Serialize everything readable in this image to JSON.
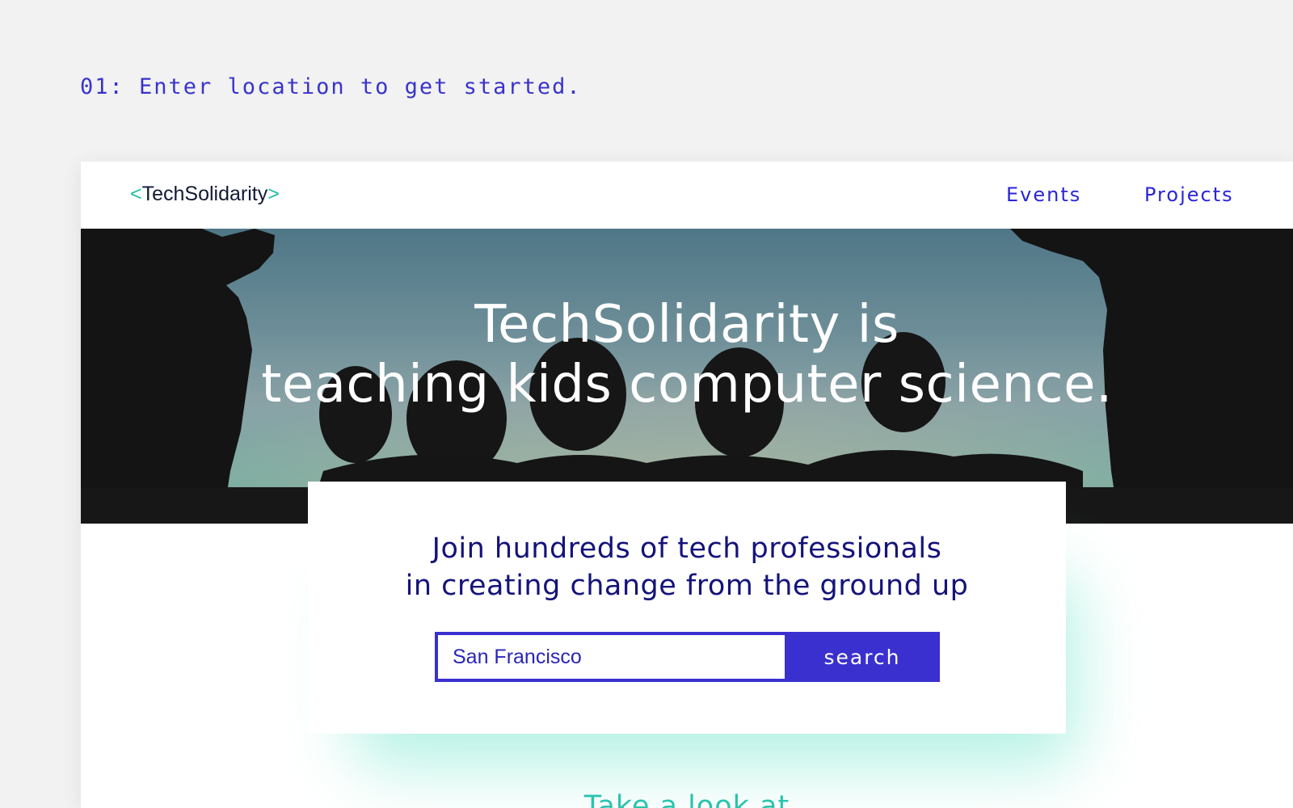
{
  "step": {
    "caption": "01: Enter location to get started."
  },
  "brand": {
    "open_bracket": "<",
    "name": "TechSolidarity",
    "close_bracket": ">",
    "accent_color": "#1fbfa6",
    "primary_color": "#3a30cf"
  },
  "nav": {
    "items": [
      {
        "label": "Events"
      },
      {
        "label": "Projects"
      }
    ]
  },
  "hero": {
    "title_line1": "TechSolidarity is",
    "title_line2": "teaching kids computer science."
  },
  "cta": {
    "heading_line1": "Join hundreds of tech professionals",
    "heading_line2": "in creating change from the ground up",
    "search": {
      "value": "San Francisco",
      "button_label": "search"
    }
  },
  "next_section": {
    "heading": "Take a look at"
  }
}
